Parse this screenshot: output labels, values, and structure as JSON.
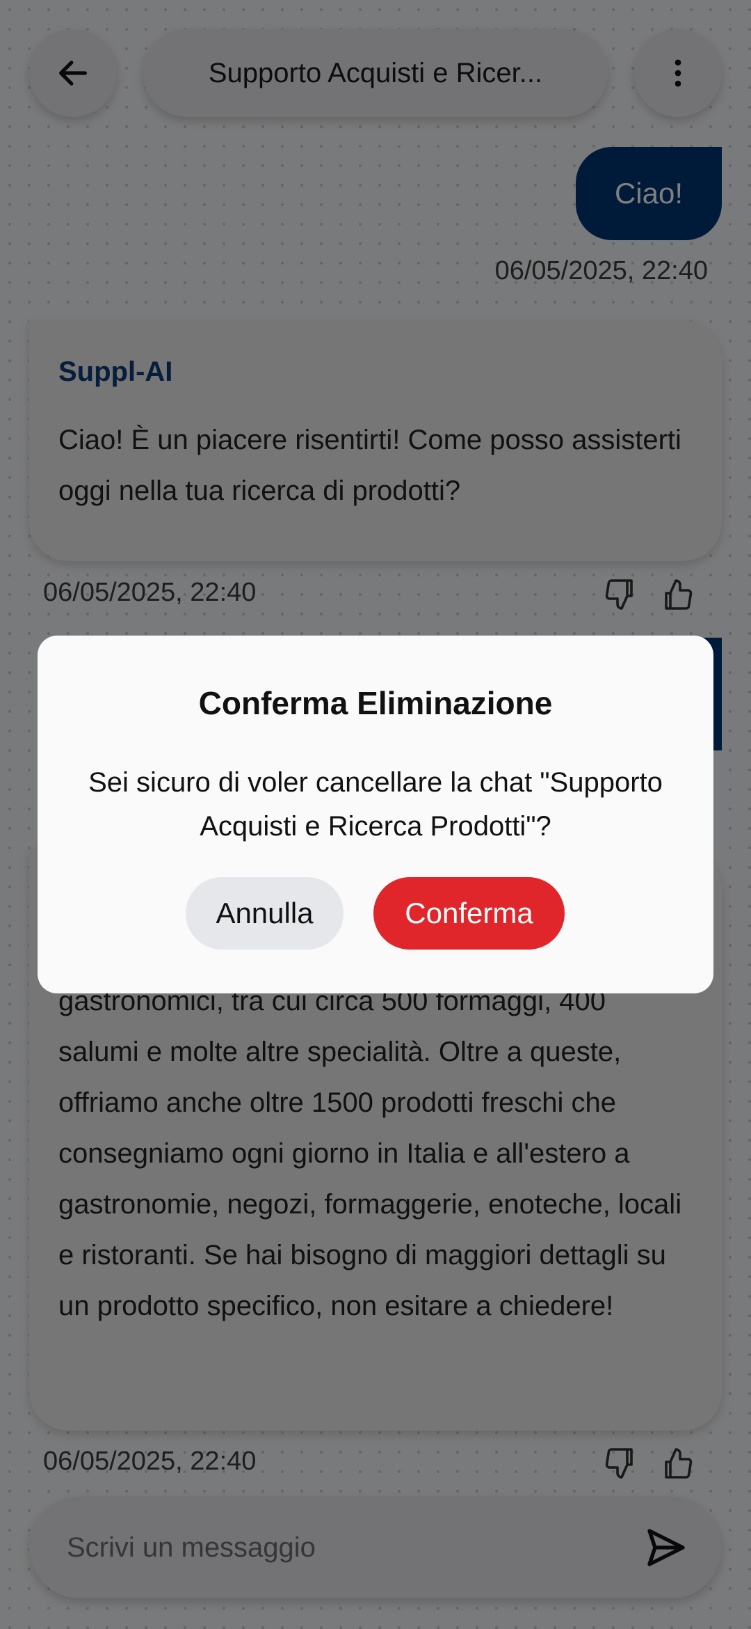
{
  "header": {
    "title": "Supporto Acquisti e Ricer..."
  },
  "messages": [
    {
      "role": "user",
      "text": "Ciao!",
      "timestamp": "06/05/2025, 22:40"
    },
    {
      "role": "assistant",
      "sender": "Suppl-AI",
      "text": "Ciao! È un piacere risentirti! Come posso assisterti oggi nella tua ricerca di prodotti?",
      "timestamp": "06/05/2025, 22:40"
    },
    {
      "role": "assistant",
      "text": "gastronomici, tra cui circa 500 formaggi, 400 salumi e molte altre specialità. Oltre a queste, offriamo anche oltre 1500 prodotti freschi che consegniamo ogni giorno in Italia e all'estero a gastronomie, negozi, formaggerie, enoteche, locali e ristoranti. Se hai bisogno di maggiori dettagli su un prodotto specifico, non esitare a chiedere!",
      "timestamp": "06/05/2025, 22:40"
    }
  ],
  "input": {
    "placeholder": "Scrivi un messaggio"
  },
  "dialog": {
    "title": "Conferma Eliminazione",
    "text": "Sei sicuro di voler cancellare la chat \"Supporto Acquisti e Ricerca Prodotti\"?",
    "cancel_label": "Annulla",
    "confirm_label": "Conferma"
  },
  "colors": {
    "accent": "#003575",
    "danger": "#e0262a"
  }
}
